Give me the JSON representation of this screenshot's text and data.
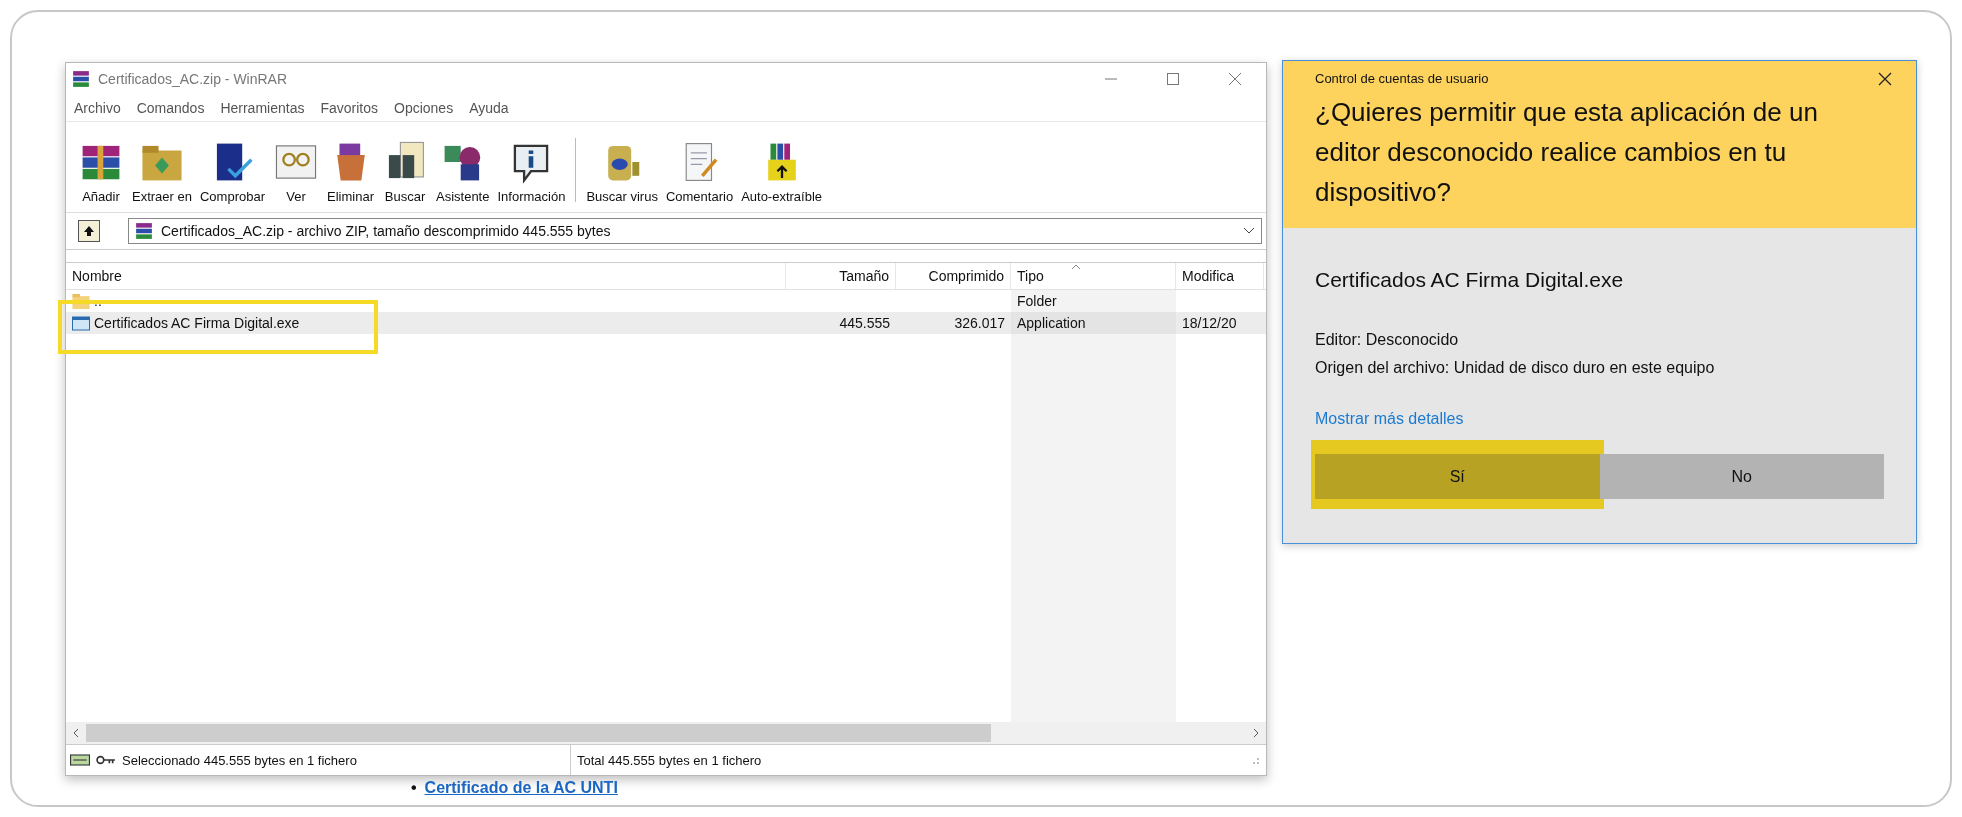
{
  "winrar": {
    "title": "Certificados_AC.zip - WinRAR",
    "menu": [
      "Archivo",
      "Comandos",
      "Herramientas",
      "Favoritos",
      "Opciones",
      "Ayuda"
    ],
    "toolbar": [
      {
        "buttons": [
          "Añadir",
          "Extraer en",
          "Comprobar",
          "Ver",
          "Eliminar",
          "Buscar",
          "Asistente",
          "Información"
        ]
      },
      {
        "buttons": [
          "Buscar virus",
          "Comentario",
          "Auto-extraíble"
        ]
      }
    ],
    "address": "Certificados_AC.zip - archivo ZIP, tamaño descomprimido 445.555 bytes",
    "columns": [
      {
        "label": "Nombre",
        "sorted": false
      },
      {
        "label": "Tamaño",
        "sorted": false
      },
      {
        "label": "Comprimido",
        "sorted": false
      },
      {
        "label": "Tipo",
        "sorted": true
      },
      {
        "label": "Modifica",
        "sorted": false
      }
    ],
    "rows": [
      {
        "kind": "folder",
        "name": "..",
        "type": "Folder",
        "selected": false,
        "highlighted": false
      },
      {
        "kind": "file",
        "name": "Certificados AC Firma Digital.exe",
        "size": "445.555",
        "packed": "326.017",
        "type": "Application",
        "modified": "18/12/20",
        "selected": true,
        "highlighted": true
      }
    ],
    "status": {
      "selected": "Seleccionado 445.555 bytes en 1 fichero",
      "total": "Total 445.555 bytes en 1 fichero"
    }
  },
  "background_link": {
    "bullet": "•",
    "text": "Certificado de la AC UNTI"
  },
  "uac": {
    "caption": "Control de cuentas de usuario",
    "question": "¿Quieres permitir que esta aplicación de un editor desconocido realice cambios en tu dispositivo?",
    "program": "Certificados AC Firma Digital.exe",
    "details": [
      "Editor: Desconocido",
      "Origen del archivo: Unidad de disco duro en este equipo"
    ],
    "link": "Mostrar más detalles",
    "buttons": [
      {
        "label": "Sí",
        "highlighted": true
      },
      {
        "label": "No",
        "highlighted": false
      }
    ]
  }
}
